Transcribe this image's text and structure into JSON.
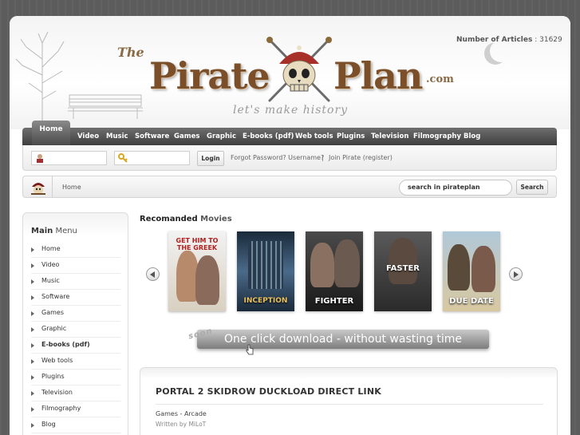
{
  "site": {
    "logo_the": "The",
    "logo_pirate": "Pirate",
    "logo_plan": "Plan",
    "logo_com": ".com",
    "logo_slogan": "let's make history",
    "articles_label": "Number of Articles",
    "articles_count": ": 31629"
  },
  "nav": {
    "items": [
      "Home",
      "Video",
      "Music",
      "Software",
      "Games",
      "Graphic",
      "E-books (pdf)",
      "Web tools",
      "Plugins",
      "Television",
      "Filmography",
      "Blog"
    ]
  },
  "login": {
    "button": "Login",
    "forgot": "Forgot Password? Username?",
    "separator": "|",
    "join": "Join Pirate (register)"
  },
  "breadcrumb": {
    "home": "Home"
  },
  "search": {
    "placeholder": "search in pirateplan",
    "button": "Search"
  },
  "menu": {
    "title_bold": "Main",
    "title_rest": "Menu",
    "items": [
      "Home",
      "Video",
      "Music",
      "Software",
      "Games",
      "Graphic",
      "E-books (pdf)",
      "Web tools",
      "Plugins",
      "Television",
      "Filmography",
      "Blog"
    ]
  },
  "recommended": {
    "title_bold": "Recomanded",
    "title_rest": "Movies",
    "posters": [
      {
        "top": "GET HIM TO THE GREEK",
        "bottom": ""
      },
      {
        "top": "",
        "bottom": "INCEPTION"
      },
      {
        "top": "",
        "bottom": "FIGHTER"
      },
      {
        "top": "",
        "bottom": "FASTER"
      },
      {
        "top": "",
        "bottom": "DUE DATE"
      }
    ]
  },
  "banner": {
    "soon": "soon",
    "text": "One click download - without wasting time"
  },
  "post": {
    "title": "PORTAL 2 SKIDROW DUCKLOAD DIRECT LINK",
    "category": "Games - Arcade",
    "author": "Written by MiLoT"
  },
  "colors": {
    "logo_brown": "#7a4f2a",
    "nav_dark": "#3f3f3f",
    "background": "#5c5c5c"
  }
}
